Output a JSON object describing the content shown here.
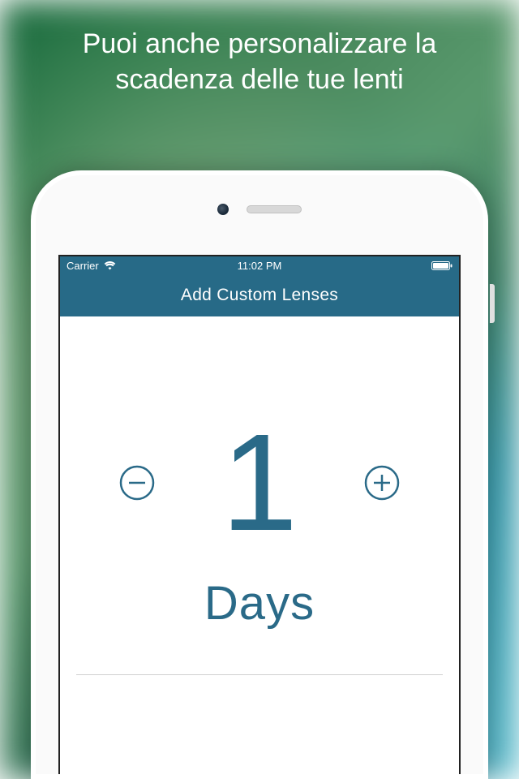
{
  "headline": "Puoi anche personalizzare la scadenza delle tue lenti",
  "status_bar": {
    "carrier": "Carrier",
    "time": "11:02 PM"
  },
  "nav_bar": {
    "title": "Add Custom Lenses"
  },
  "counter": {
    "value": "1",
    "unit": "Days"
  },
  "colors": {
    "accent": "#276a87"
  }
}
